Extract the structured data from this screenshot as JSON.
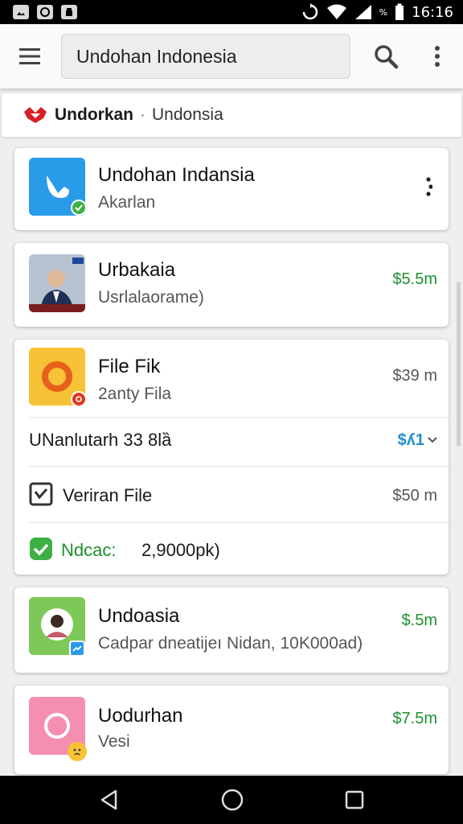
{
  "status_bar": {
    "time": "16:16",
    "battery_label": "%"
  },
  "toolbar": {
    "search_text": "Undohan Indonesia"
  },
  "brand": {
    "name": "Undorkan",
    "separator": "·",
    "subtitle": "Undonsia"
  },
  "items": [
    {
      "title": "Undohan Indansia",
      "subtitle": "Akarlan",
      "price": ""
    },
    {
      "title": "Urbakaia",
      "subtitle": "Usrlalaorame)",
      "price": "$5.5m"
    },
    {
      "title": "File Fik",
      "subtitle": "2anty Fila",
      "price": "$39 m"
    },
    {
      "title": "Undoasia",
      "subtitle": "Cadpar dneatijeı Nidan, 10K000ad)",
      "price": "$.5m"
    },
    {
      "title": "Uodurhan",
      "subtitle": "Vesi",
      "price": "$7.5m"
    }
  ],
  "file_rows": [
    {
      "label": "UNanlutarh 33 8lȁ",
      "value": "$ʎ1"
    },
    {
      "label": "Veriran File",
      "value": "$50 m"
    },
    {
      "label": "Ndcac:",
      "value": "2,9000pk)"
    }
  ],
  "colors": {
    "green_price": "#1f8f2f",
    "blue_price": "#1f8fcf",
    "brand_red": "#d6202a",
    "app_blue": "#2a9be8",
    "app_orange": "#f7c236",
    "app_green": "#7ec85a",
    "app_pink": "#f48fb1"
  }
}
